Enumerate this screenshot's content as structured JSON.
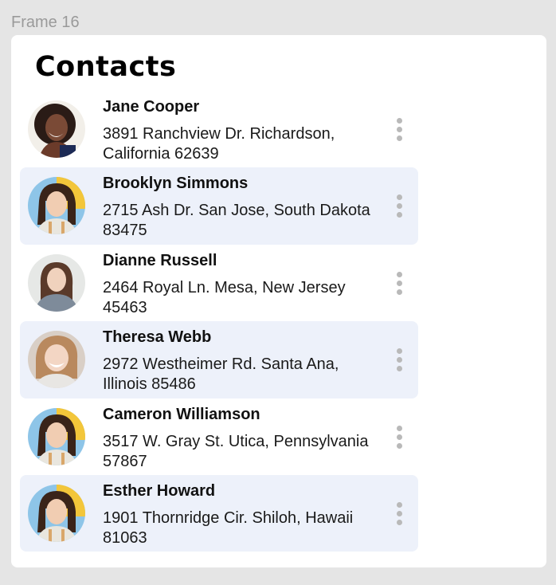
{
  "frame": {
    "label": "Frame 16"
  },
  "title": "Contacts",
  "contacts": [
    {
      "name": "Jane Cooper",
      "address": "3891 Ranchview Dr. Richardson, California 62639",
      "avatar": "avatar-photo-woman-curly-hair"
    },
    {
      "name": "Brooklyn Simmons",
      "address": "2715 Ash Dr. San Jose, South Dakota 83475",
      "avatar": "avatar-photo-woman-yellow-background"
    },
    {
      "name": "Dianne Russell",
      "address": "2464 Royal Ln. Mesa, New Jersey 45463",
      "avatar": "avatar-photo-woman-brown-hair"
    },
    {
      "name": "Theresa Webb",
      "address": "2972 Westheimer Rd. Santa Ana, Illinois 85486",
      "avatar": "avatar-photo-woman-laughing"
    },
    {
      "name": "Cameron Williamson",
      "address": "3517 W. Gray St. Utica, Pennsylvania 57867",
      "avatar": "avatar-photo-woman-yellow-background"
    },
    {
      "name": "Esther Howard",
      "address": "1901 Thornridge Cir. Shiloh, Hawaii 81063",
      "avatar": "avatar-photo-woman-yellow-background"
    }
  ],
  "colors": {
    "canvas": "#e5e5e5",
    "card": "#ffffff",
    "row_highlight": "#edf1fa",
    "more_dots": "#b9b9b9"
  },
  "icons": {
    "row_menu": "more-vertical-icon"
  }
}
